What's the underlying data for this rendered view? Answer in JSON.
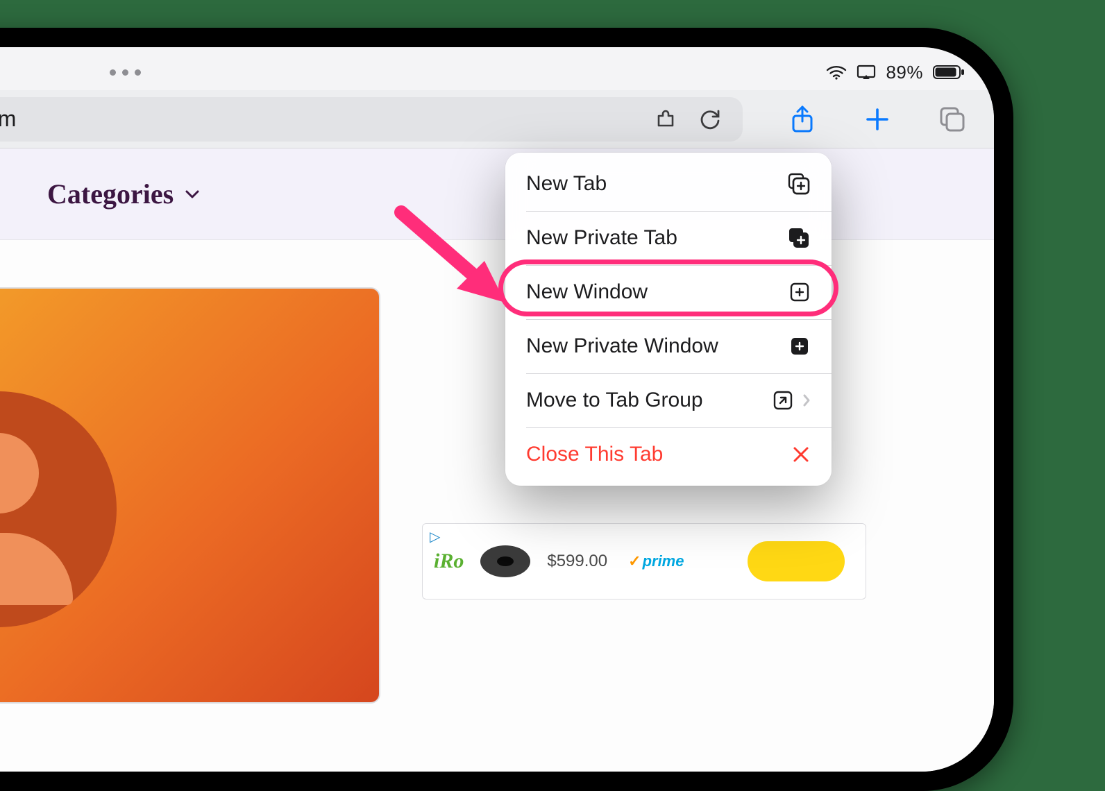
{
  "status": {
    "battery_pct": "89%"
  },
  "toolbar": {
    "url": "macreports.com"
  },
  "page": {
    "categories_label": "Categories"
  },
  "ad": {
    "brand_fragment": "iRo",
    "price": "$599.00",
    "prime_label": "prime"
  },
  "menu": {
    "items": [
      {
        "label": "New Tab",
        "icon": "new-tab-icon"
      },
      {
        "label": "New Private Tab",
        "icon": "new-private-tab-icon"
      },
      {
        "label": "New Window",
        "icon": "new-window-icon",
        "highlighted": true
      },
      {
        "label": "New Private Window",
        "icon": "new-private-window-icon"
      },
      {
        "label": "Move to Tab Group",
        "icon": "move-to-group-icon",
        "chevron": true
      },
      {
        "label": "Close This Tab",
        "icon": "close-icon",
        "danger": true
      }
    ]
  }
}
